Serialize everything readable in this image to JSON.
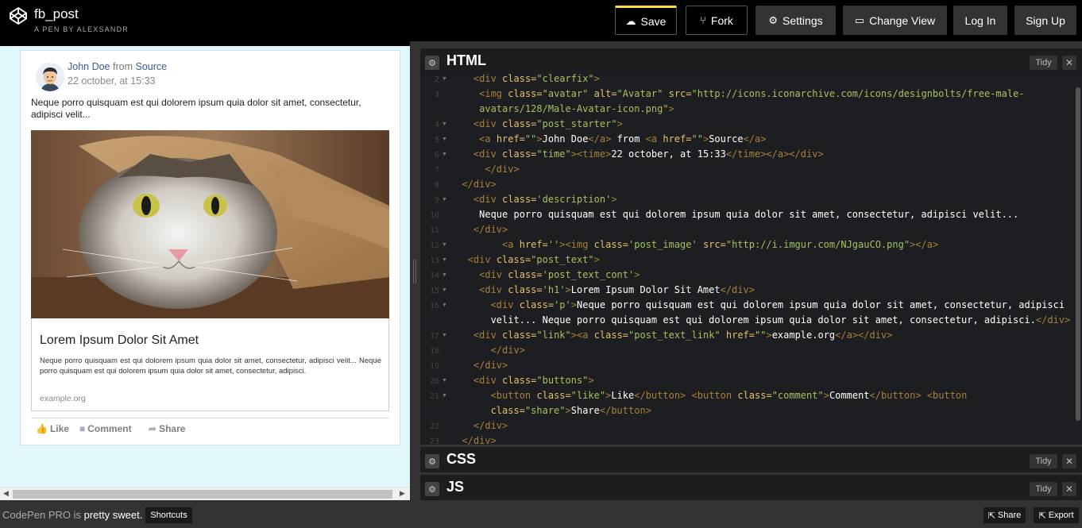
{
  "header": {
    "pen_title": "fb_post",
    "pen_author": "A PEN BY ALEXSANDR",
    "buttons": {
      "save": "Save",
      "fork": "Fork",
      "settings": "Settings",
      "change_view": "Change View",
      "login": "Log In",
      "signup": "Sign Up"
    }
  },
  "preview": {
    "author_name": "John Doe",
    "from_text": "from",
    "source_text": "Source",
    "time": "22 october, at 15:33",
    "description": "Neque porro quisquam est qui dolorem ipsum quia dolor sit amet, consectetur, adipisci velit...",
    "post_title": "Lorem Ipsum Dolor Sit Amet",
    "post_paragraph": "Neque porro quisquam est qui dolorem ipsum quia dolor sit amet, consectetur, adipisci velit... Neque porro quisquam est qui dolorem ipsum quia dolor sit amet, consectetur, adipisci.",
    "post_link": "example.org",
    "buttons": {
      "like": "Like",
      "comment": "Comment",
      "share": "Share"
    }
  },
  "editors": {
    "html": {
      "title": "HTML",
      "tidy": "Tidy",
      "close": "✕"
    },
    "css": {
      "title": "CSS",
      "tidy": "Tidy",
      "close": "✕"
    },
    "js": {
      "title": "JS",
      "tidy": "Tidy",
      "close": "✕"
    }
  },
  "code_lines": [
    {
      "n": "2",
      "fold": true,
      "html": "    <span class='t-tag'>&lt;div</span> <span class='t-attr'>class=</span><span class='t-str'>\"clearfix\"</span><span class='t-tag'>&gt;</span>"
    },
    {
      "n": "3",
      "fold": false,
      "html": "     <span class='t-tag'>&lt;img</span> <span class='t-attr'>class=</span><span class='t-str'>\"avatar\"</span> <span class='t-attr'>alt=</span><span class='t-str'>\"Avatar\"</span> <span class='t-attr'>src=</span><span class='t-str'>\"http://icons.iconarchive.com/icons/designbolts/free-male-</span>"
    },
    {
      "n": "",
      "fold": false,
      "html": "     <span class='t-str'>avatars/128/Male-Avatar-icon.png\"</span><span class='t-tag'>&gt;</span>"
    },
    {
      "n": "4",
      "fold": true,
      "html": "    <span class='t-tag'>&lt;div</span> <span class='t-attr'>class=</span><span class='t-str'>\"post_starter\"</span><span class='t-tag'>&gt;</span>"
    },
    {
      "n": "5",
      "fold": true,
      "html": "     <span class='t-tag'>&lt;a</span> <span class='t-attr'>href=</span><span class='t-str'>\"\"</span><span class='t-tag'>&gt;</span><span class='t-txt'>John Doe</span><span class='t-tag'>&lt;/a&gt;</span> <span class='t-txt'>from</span> <span class='t-tag'>&lt;a</span> <span class='t-attr'>href=</span><span class='t-str'>\"\"</span><span class='t-tag'>&gt;</span><span class='t-txt'>Source</span><span class='t-tag'>&lt;/a&gt;</span>"
    },
    {
      "n": "6",
      "fold": true,
      "html": "    <span class='t-tag'>&lt;div</span> <span class='t-attr'>class=</span><span class='t-str'>\"time\"</span><span class='t-tag'>&gt;&lt;time&gt;</span><span class='t-txt'>22 october, at 15:33</span><span class='t-tag'>&lt;/time&gt;&lt;/a&gt;&lt;/div&gt;</span>"
    },
    {
      "n": "7",
      "fold": false,
      "html": "      <span class='t-tag'>&lt;/div&gt;</span>"
    },
    {
      "n": "8",
      "fold": false,
      "html": "  <span class='t-tag'>&lt;/div&gt;</span>"
    },
    {
      "n": "9",
      "fold": true,
      "html": "    <span class='t-tag'>&lt;div</span> <span class='t-attr'>class=</span><span class='t-str'>'description'</span><span class='t-tag'>&gt;</span>"
    },
    {
      "n": "10",
      "fold": false,
      "html": "     <span class='t-txt'>Neque porro quisquam est qui dolorem ipsum quia dolor sit amet, consectetur, adipisci velit...</span>"
    },
    {
      "n": "11",
      "fold": false,
      "html": "    <span class='t-tag'>&lt;/div&gt;</span>"
    },
    {
      "n": "12",
      "fold": true,
      "html": "         <span class='t-tag'>&lt;a</span> <span class='t-attr'>href=</span><span class='t-str'>''</span><span class='t-tag'>&gt;&lt;img</span> <span class='t-attr'>class=</span><span class='t-str'>'post_image'</span> <span class='t-attr'>src=</span><span class='t-str'>\"http://i.imgur.com/NJgauCO.png\"</span><span class='t-tag'>&gt;&lt;/a&gt;</span>"
    },
    {
      "n": "13",
      "fold": true,
      "html": "   <span class='t-tag'>&lt;div</span> <span class='t-attr'>class=</span><span class='t-str'>\"post_text\"</span><span class='t-tag'>&gt;</span>"
    },
    {
      "n": "14",
      "fold": true,
      "html": "     <span class='t-tag'>&lt;div</span> <span class='t-attr'>class=</span><span class='t-str'>'post_text_cont'</span><span class='t-tag'>&gt;</span>"
    },
    {
      "n": "15",
      "fold": true,
      "html": "     <span class='t-tag'>&lt;div</span> <span class='t-attr'>class=</span><span class='t-str'>'h1'</span><span class='t-tag'>&gt;</span><span class='t-txt'>Lorem Ipsum Dolor Sit Amet</span><span class='t-tag'>&lt;/div&gt;</span>"
    },
    {
      "n": "16",
      "fold": true,
      "html": "       <span class='t-tag'>&lt;div</span> <span class='t-attr'>class=</span><span class='t-str'>'p'</span><span class='t-tag'>&gt;</span><span class='t-txt'>Neque porro quisquam est qui dolorem ipsum quia dolor sit amet, consectetur, adipisci</span>"
    },
    {
      "n": "",
      "fold": false,
      "html": "       <span class='t-txt'>velit... Neque porro quisquam est qui dolorem ipsum quia dolor sit amet, consectetur, adipisci.</span><span class='t-tag'>&lt;/div&gt;</span>"
    },
    {
      "n": "17",
      "fold": true,
      "html": "    <span class='t-tag'>&lt;div</span> <span class='t-attr'>class=</span><span class='t-str'>\"link\"</span><span class='t-tag'>&gt;&lt;a</span> <span class='t-attr'>class=</span><span class='t-str'>\"post_text_link\"</span> <span class='t-attr'>href=</span><span class='t-str'>\"\"</span><span class='t-tag'>&gt;</span><span class='t-txt'>example.org</span><span class='t-tag'>&lt;/a&gt;&lt;/div&gt;</span>"
    },
    {
      "n": "18",
      "fold": false,
      "html": "       <span class='t-tag'>&lt;/div&gt;</span>"
    },
    {
      "n": "19",
      "fold": false,
      "html": "    <span class='t-tag'>&lt;/div&gt;</span>"
    },
    {
      "n": "20",
      "fold": true,
      "html": "    <span class='t-tag'>&lt;div</span> <span class='t-attr'>class=</span><span class='t-str'>\"buttons\"</span><span class='t-tag'>&gt;</span>"
    },
    {
      "n": "21",
      "fold": true,
      "html": "       <span class='t-tag'>&lt;button</span> <span class='t-attr'>class=</span><span class='t-str'>\"like\"</span><span class='t-tag'>&gt;</span><span class='t-txt'>Like</span><span class='t-tag'>&lt;/button&gt;</span> <span class='t-tag'>&lt;button</span> <span class='t-attr'>class=</span><span class='t-str'>\"comment\"</span><span class='t-tag'>&gt;</span><span class='t-txt'>Comment</span><span class='t-tag'>&lt;/button&gt;</span> <span class='t-tag'>&lt;button</span>"
    },
    {
      "n": "",
      "fold": false,
      "html": "       <span class='t-attr'>class=</span><span class='t-str'>\"share\"</span><span class='t-tag'>&gt;</span><span class='t-txt'>Share</span><span class='t-tag'>&lt;/button&gt;</span>"
    },
    {
      "n": "22",
      "fold": false,
      "html": "    <span class='t-tag'>&lt;/div&gt;</span>"
    },
    {
      "n": "23",
      "fold": false,
      "html": "  <span class='t-tag'>&lt;/div&gt;</span>"
    }
  ],
  "bottom_bar": {
    "promo_prefix": "CodePen PRO is",
    "promo_emph": "pretty sweet.",
    "shortcuts": "Shortcuts",
    "share": "Share",
    "export": "Export"
  },
  "colors": {
    "save_accent": "#ffdd40",
    "preview_bg": "#e0f8fb",
    "link": "#3b5998",
    "editor_bg": "#1d1e22",
    "code_tag": "#a88038",
    "code_attr": "#e8bf6a",
    "code_string": "#a5c25c"
  }
}
